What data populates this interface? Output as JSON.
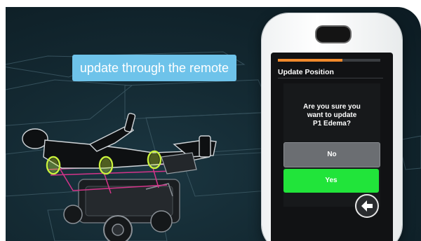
{
  "callout": {
    "text": "update through the remote"
  },
  "remote": {
    "screen_title": "Update Position",
    "progress_fraction": 0.63,
    "question_line1": "Are you sure you",
    "question_line2": "want to update",
    "question_line3": "P1 Edema?",
    "no_label": "No",
    "yes_label": "Yes",
    "back_icon": "arrow-left-icon"
  },
  "colors": {
    "background": "#142a33",
    "callout": "#6ec3ea",
    "progress": "#f18a2c",
    "yes_button": "#21e43a",
    "no_button": "#6b6e72",
    "highlight_circles": "#c8f03c",
    "frame_lines": "#d4348a"
  }
}
